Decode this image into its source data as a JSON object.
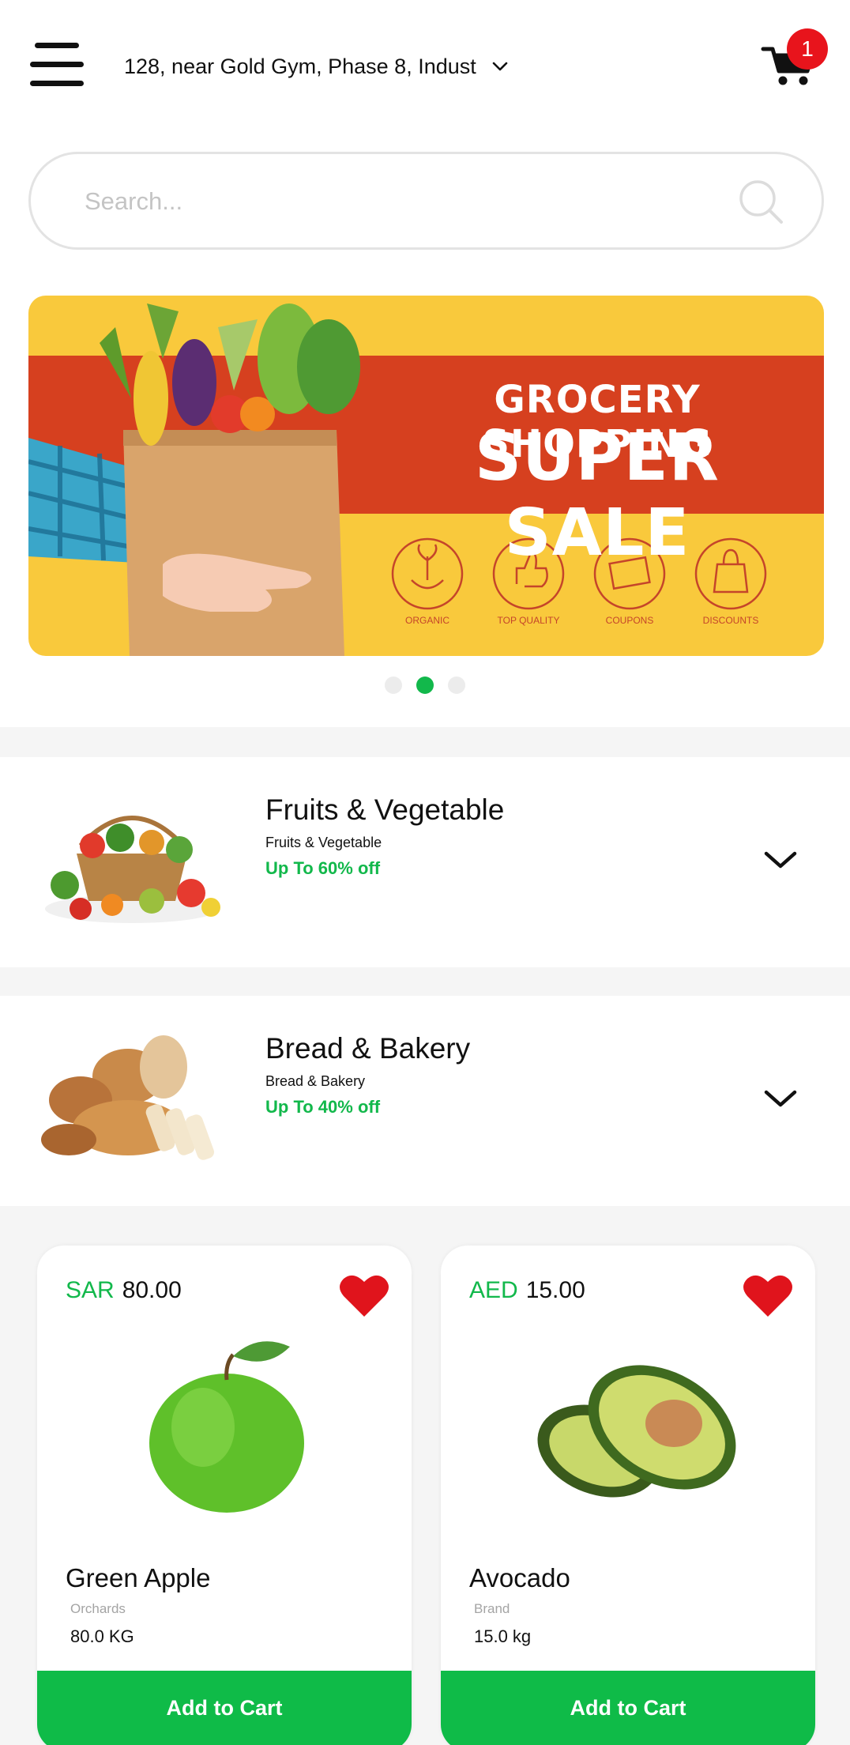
{
  "header": {
    "menu_icon": "hamburger-menu-icon",
    "address": "128, near Gold Gym, Phase 8, Indust",
    "address_chevron_icon": "chevron-down-icon",
    "cart_icon": "shopping-cart-icon",
    "cart_count": "1"
  },
  "search": {
    "placeholder": "Search...",
    "icon": "search-icon"
  },
  "banner": {
    "title_line1": "GROCERY SHOPPING",
    "title_line2": "SUPER SALE",
    "badges": [
      "ORGANIC",
      "TOP QUALITY",
      "COUPONS",
      "DISCOUNTS"
    ],
    "pagination": {
      "count": 3,
      "active_index": 1
    }
  },
  "categories": [
    {
      "title": "Fruits & Vegetable",
      "subtitle": "Fruits & Vegetable",
      "offer": "Up To 60% off",
      "image": "fruits-vegetables-basket-image",
      "chevron_icon": "chevron-down-icon"
    },
    {
      "title": "Bread & Bakery",
      "subtitle": "Bread & Bakery",
      "offer": "Up To 40% off",
      "image": "bread-bakery-image",
      "chevron_icon": "chevron-down-icon"
    }
  ],
  "products": [
    {
      "currency": "SAR",
      "price": "80.00",
      "name": "Green Apple",
      "brand": "Orchards",
      "quantity": "80.0 KG",
      "button": "Add to Cart",
      "favorite_icon": "heart-icon",
      "image": "green-apple-image"
    },
    {
      "currency": "AED",
      "price": "15.00",
      "name": "Avocado",
      "brand": "Brand",
      "quantity": "15.0 kg",
      "button": "Add to Cart",
      "favorite_icon": "heart-icon",
      "image": "avocado-image"
    }
  ],
  "colors": {
    "accent_green": "#12b84b",
    "button_green": "#0fbb48",
    "badge_red": "#e8141c",
    "heart_red": "#e0141c",
    "banner_yellow": "#f9c93c",
    "banner_red": "#d6401f"
  }
}
